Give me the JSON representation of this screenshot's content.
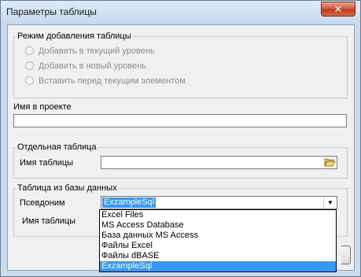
{
  "window": {
    "title": "Параметры таблицы",
    "close_glyph": "✕"
  },
  "mode_group": {
    "title": "Режим добавления таблицы",
    "options": [
      {
        "label": "Добавить в текущий уровень",
        "checked": false,
        "enabled": false
      },
      {
        "label": "Добавить в новый уровень",
        "checked": false,
        "enabled": false
      },
      {
        "label": "Вставить перед текущим элементом",
        "checked": false,
        "enabled": false
      }
    ]
  },
  "project_name": {
    "label": "Имя в проекте",
    "value": ""
  },
  "separate_table": {
    "title": "Отдельная таблица",
    "table_name_label": "Имя таблицы",
    "table_name_value": "",
    "browse_icon": "folder-open-icon"
  },
  "db_table": {
    "title": "Таблица из базы данных",
    "alias_label": "Псевдоним",
    "alias_value": "ExzampleSql",
    "table_name_label": "Имя таблицы",
    "alias_options": [
      {
        "label": "Excel Files",
        "selected": false
      },
      {
        "label": "MS Access Database",
        "selected": false
      },
      {
        "label": "База данных MS Access",
        "selected": false
      },
      {
        "label": "Файлы Excel",
        "selected": false
      },
      {
        "label": "Файлы dBASE",
        "selected": false
      },
      {
        "label": "ExzampleSql",
        "selected": true
      }
    ]
  },
  "colors": {
    "selection": "#3399ff",
    "dialog_bg": "#f0f0f0",
    "frame": "#c9dbee",
    "close_button": "#c23a1e"
  }
}
